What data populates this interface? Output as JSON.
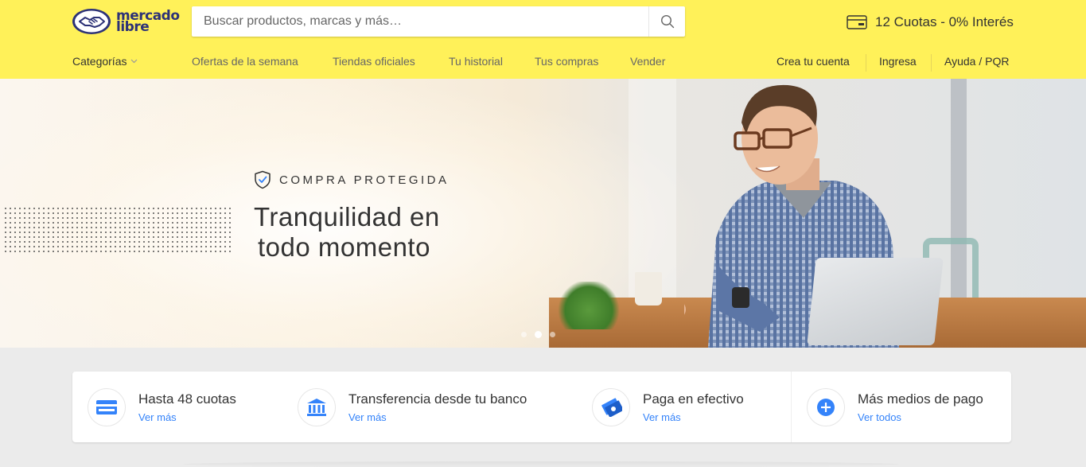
{
  "brand": {
    "line1": "mercado",
    "line2": "libre",
    "header_bg": "#fff159",
    "logo_blue": "#2d3277"
  },
  "search": {
    "placeholder": "Buscar productos, marcas y más…",
    "icon": "search-icon"
  },
  "promo": {
    "text": "12 Cuotas - 0% Interés",
    "icon": "credit-card-icon"
  },
  "nav": {
    "categories": "Categorías",
    "links": [
      "Ofertas de la semana",
      "Tiendas oficiales",
      "Tu historial",
      "Tus compras",
      "Vender"
    ],
    "account": [
      "Crea tu cuenta",
      "Ingresa",
      "Ayuda / PQR"
    ]
  },
  "hero": {
    "badge": "COMPRA PROTEGIDA",
    "headline_line1": "Tranquilidad en",
    "headline_line2": "todo momento",
    "slides": 3,
    "active_slide": 2
  },
  "payments": {
    "items": [
      {
        "title": "Hasta 48 cuotas",
        "link": "Ver más",
        "icon": "credit-card-icon"
      },
      {
        "title": "Transferencia desde tu banco",
        "link": "Ver más",
        "icon": "bank-icon"
      },
      {
        "title": "Paga en efectivo",
        "link": "Ver más",
        "icon": "cash-icon"
      },
      {
        "title": "Más medios de pago",
        "link": "Ver todos",
        "icon": "plus-icon"
      }
    ],
    "link_color": "#3483fa"
  }
}
